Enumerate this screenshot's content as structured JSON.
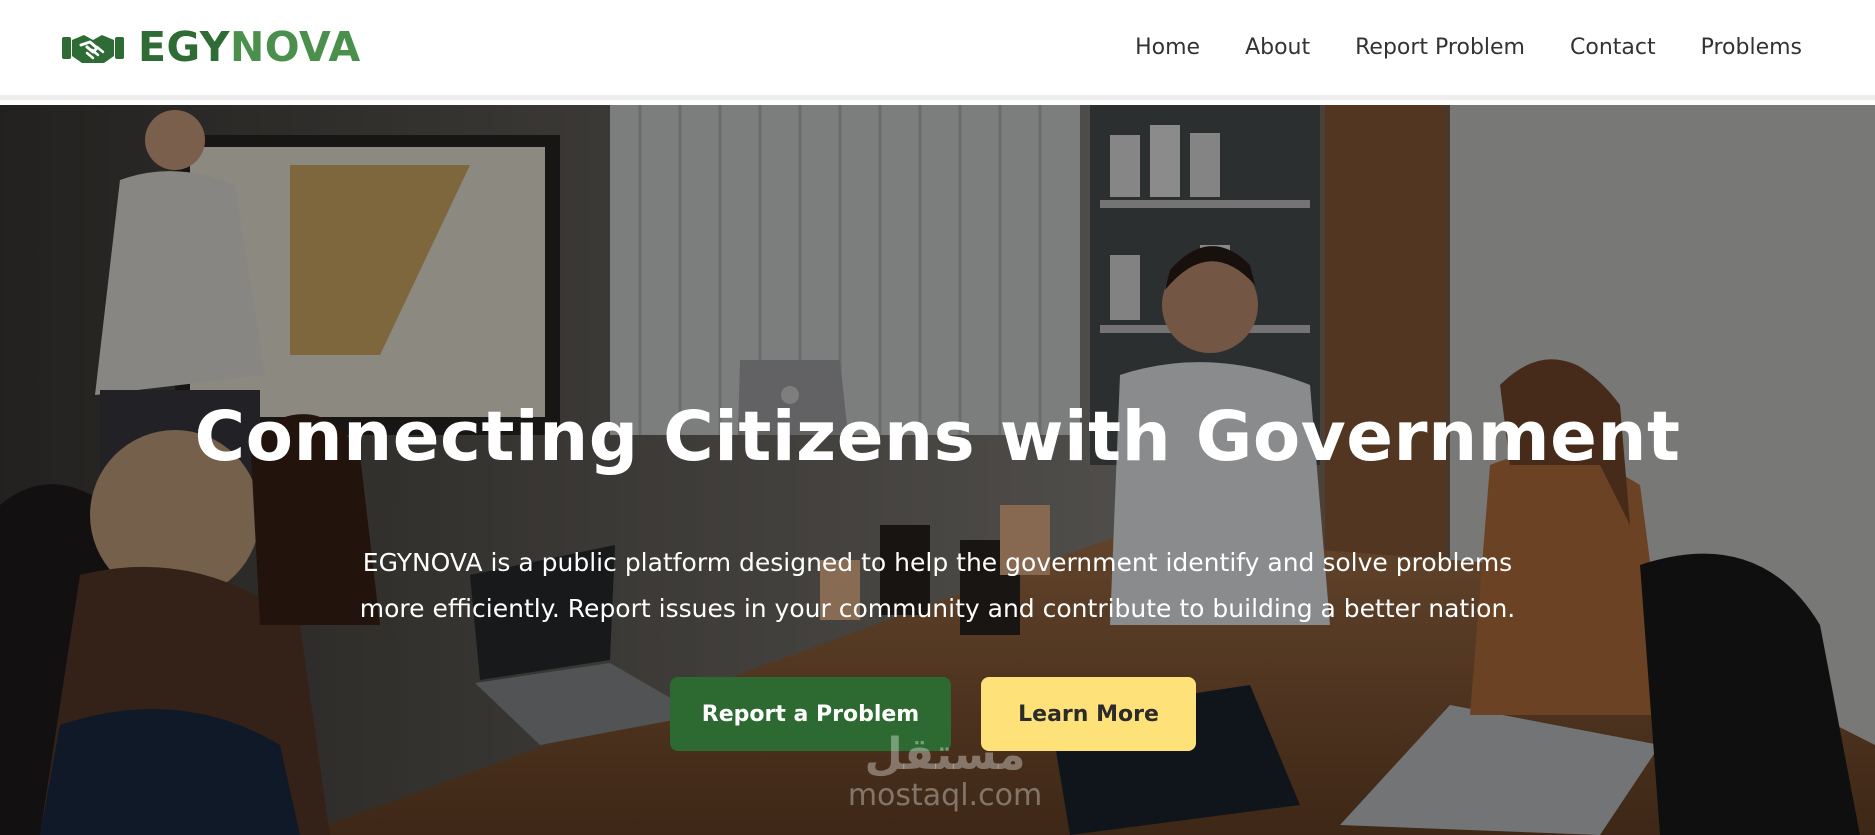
{
  "brand": {
    "name_part1": "EGY",
    "name_part2": "NOVA",
    "logo_icon": "handshake-icon",
    "color_dark": "#2f6b35",
    "color_light": "#4b8f4d"
  },
  "nav": {
    "items": [
      {
        "label": "Home"
      },
      {
        "label": "About"
      },
      {
        "label": "Report Problem"
      },
      {
        "label": "Contact"
      },
      {
        "label": "Problems"
      }
    ]
  },
  "hero": {
    "title": "Connecting Citizens with Government",
    "description_line1": "EGYNOVA is a public platform designed to help the government identify and solve problems",
    "description_line2": "more efficiently. Report issues in your community and contribute to building a better nation.",
    "background_image": "office-meeting-photo",
    "primary_button": {
      "label": "Report a Problem",
      "color": "#2d6a31"
    },
    "secondary_button": {
      "label": "Learn More",
      "color": "#ffe17a"
    }
  },
  "watermark": {
    "arabic": "مستقل",
    "latin": "mostaql.com"
  }
}
